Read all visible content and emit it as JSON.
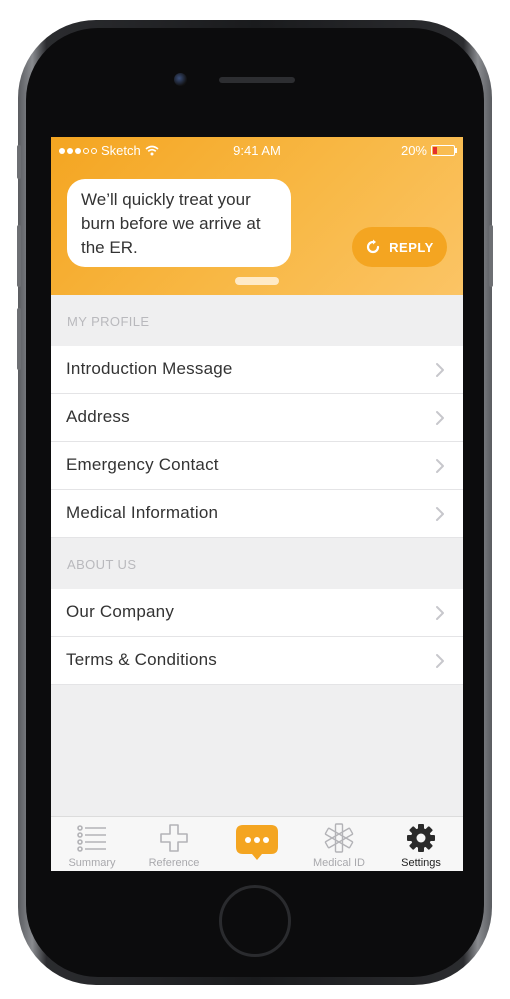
{
  "status_bar": {
    "carrier": "Sketch",
    "time": "9:41 AM",
    "battery_percent": "20%",
    "battery_level": 0.2
  },
  "header": {
    "message": "We’ll quickly treat your burn before we arrive at the ER.",
    "reply_label": "REPLY"
  },
  "sections": {
    "my_profile": {
      "title": "MY PROFILE",
      "items": [
        "Introduction Message",
        "Address",
        "Emergency Contact",
        "Medical Information"
      ]
    },
    "about_us": {
      "title": "ABOUT US",
      "items": [
        "Our Company",
        "Terms & Conditions"
      ]
    }
  },
  "tab_bar": {
    "summary": "Summary",
    "reference": "Reference",
    "medical_id": "Medical ID",
    "settings": "Settings",
    "active": "Settings"
  },
  "colors": {
    "accent": "#f4a521",
    "battery_low": "#e5302c"
  }
}
